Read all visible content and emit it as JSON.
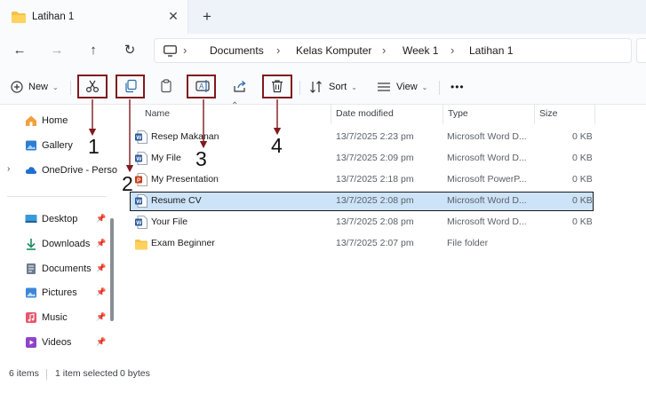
{
  "tab": {
    "title": "Latihan 1",
    "close_icon": "close-icon",
    "new_tab_icon": "plus-icon"
  },
  "breadcrumb": [
    "Documents",
    "Kelas Komputer",
    "Week 1",
    "Latihan 1"
  ],
  "toolbar": {
    "new_label": "New",
    "sort_label": "Sort",
    "view_label": "View",
    "more_label": "•••"
  },
  "sidebar": {
    "items": [
      {
        "label": "Home",
        "icon": "home-icon"
      },
      {
        "label": "Gallery",
        "icon": "gallery-icon"
      },
      {
        "label": "OneDrive - Perso",
        "icon": "cloud-icon"
      },
      {
        "label": "Desktop",
        "icon": "desktop-icon",
        "pinned": true
      },
      {
        "label": "Downloads",
        "icon": "download-icon",
        "pinned": true
      },
      {
        "label": "Documents",
        "icon": "documents-icon",
        "pinned": true
      },
      {
        "label": "Pictures",
        "icon": "pictures-icon",
        "pinned": true
      },
      {
        "label": "Music",
        "icon": "music-icon",
        "pinned": true
      },
      {
        "label": "Videos",
        "icon": "videos-icon",
        "pinned": true
      }
    ]
  },
  "columns": {
    "name": "Name",
    "date": "Date modified",
    "type": "Type",
    "size": "Size"
  },
  "files": [
    {
      "name": "Resep Makanan",
      "date": "13/7/2025 2:23 pm",
      "type": "Microsoft Word D...",
      "size": "0 KB",
      "kind": "word"
    },
    {
      "name": "My File",
      "date": "13/7/2025 2:09 pm",
      "type": "Microsoft Word D...",
      "size": "0 KB",
      "kind": "word"
    },
    {
      "name": "My Presentation",
      "date": "13/7/2025 2:18 pm",
      "type": "Microsoft PowerP...",
      "size": "0 KB",
      "kind": "powerpoint"
    },
    {
      "name": "Resume CV",
      "date": "13/7/2025 2:08 pm",
      "type": "Microsoft Word D...",
      "size": "0 KB",
      "kind": "word",
      "selected": true
    },
    {
      "name": "Your File",
      "date": "13/7/2025 2:08 pm",
      "type": "Microsoft Word D...",
      "size": "0 KB",
      "kind": "word"
    },
    {
      "name": "Exam Beginner",
      "date": "13/7/2025 2:07 pm",
      "type": "File folder",
      "size": "",
      "kind": "folder"
    }
  ],
  "status": {
    "count": "6 items",
    "selected": "1 item selected",
    "bytes": "0 bytes"
  },
  "annotations": [
    "1",
    "2",
    "3",
    "4"
  ],
  "colors": {
    "annotation": "#7f1a1f",
    "selection": "#cce3f8",
    "word": "#2b579a",
    "powerpoint": "#c43e1c",
    "folder": "#f6c04a"
  }
}
